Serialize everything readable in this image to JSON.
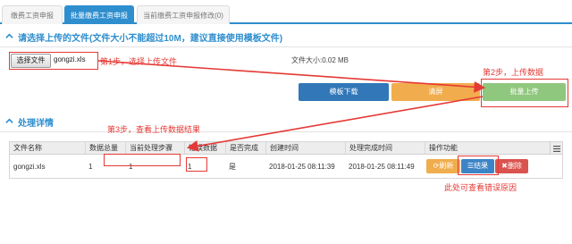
{
  "tabs": [
    {
      "label": "缴费工资申报"
    },
    {
      "label": "批量缴费工资申报"
    },
    {
      "label": "当前缴费工资申报修改(0)"
    }
  ],
  "upload_section": {
    "title": "请选择上传的文件(文件大小不能超过10M，建议直接使用模板文件)",
    "choose_file_label": "选择文件",
    "file_name": "gongzi.xls",
    "file_size_text": "文件大小:0.02 MB"
  },
  "buttons": {
    "template_download": "模板下载",
    "clear": "清屏",
    "batch_upload": "批量上传"
  },
  "annotations": {
    "step1": "第1步，选择上传文件",
    "step2": "第2步，上传数据",
    "step3": "第3步，查看上传数据结果",
    "check_error": "此处可查看错误原因"
  },
  "details_section": {
    "title": "处理详情"
  },
  "table": {
    "columns": [
      "文件名称",
      "数据总量",
      "当前处理步骤",
      "错误数据",
      "是否完成",
      "创建时间",
      "处理完成时间",
      "操作功能"
    ],
    "rows": [
      {
        "file_name": "gongzi.xls",
        "total": "1",
        "step": "1",
        "errors": "1",
        "done": "是",
        "created": "2018-01-25 08:11:39",
        "finished": "2018-01-25 08:11:49"
      }
    ],
    "actions": {
      "refresh": "刷新",
      "result": "结果",
      "delete": "删除"
    }
  },
  "colors": {
    "accent": "#2e8ece",
    "annotation": "#e53935",
    "template_button": "#3277b7",
    "clear_button": "#f1ad4d",
    "upload_button": "#8fc77e"
  }
}
